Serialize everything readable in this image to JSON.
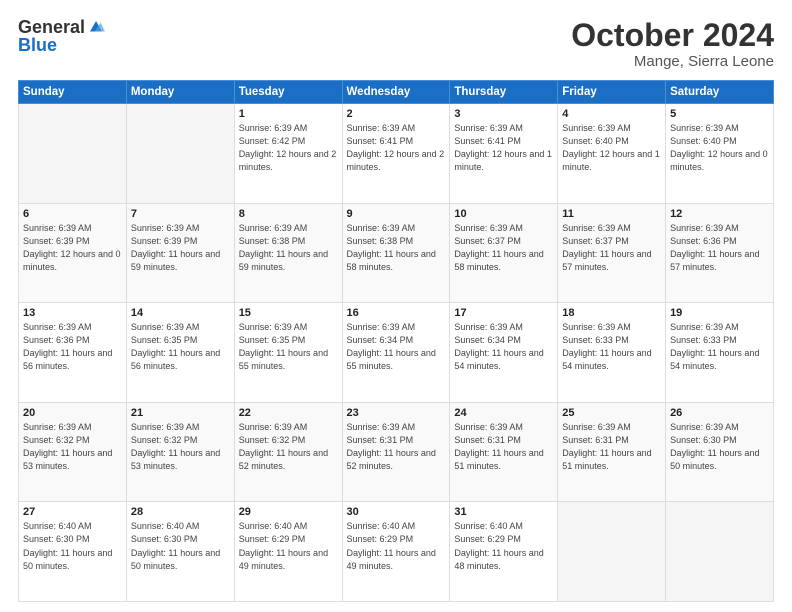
{
  "logo": {
    "general": "General",
    "blue": "Blue"
  },
  "header": {
    "month": "October 2024",
    "location": "Mange, Sierra Leone"
  },
  "days_of_week": [
    "Sunday",
    "Monday",
    "Tuesday",
    "Wednesday",
    "Thursday",
    "Friday",
    "Saturday"
  ],
  "weeks": [
    [
      {
        "day": "",
        "sunrise": "",
        "sunset": "",
        "daylight": ""
      },
      {
        "day": "",
        "sunrise": "",
        "sunset": "",
        "daylight": ""
      },
      {
        "day": "1",
        "sunrise": "Sunrise: 6:39 AM",
        "sunset": "Sunset: 6:42 PM",
        "daylight": "Daylight: 12 hours and 2 minutes."
      },
      {
        "day": "2",
        "sunrise": "Sunrise: 6:39 AM",
        "sunset": "Sunset: 6:41 PM",
        "daylight": "Daylight: 12 hours and 2 minutes."
      },
      {
        "day": "3",
        "sunrise": "Sunrise: 6:39 AM",
        "sunset": "Sunset: 6:41 PM",
        "daylight": "Daylight: 12 hours and 1 minute."
      },
      {
        "day": "4",
        "sunrise": "Sunrise: 6:39 AM",
        "sunset": "Sunset: 6:40 PM",
        "daylight": "Daylight: 12 hours and 1 minute."
      },
      {
        "day": "5",
        "sunrise": "Sunrise: 6:39 AM",
        "sunset": "Sunset: 6:40 PM",
        "daylight": "Daylight: 12 hours and 0 minutes."
      }
    ],
    [
      {
        "day": "6",
        "sunrise": "Sunrise: 6:39 AM",
        "sunset": "Sunset: 6:39 PM",
        "daylight": "Daylight: 12 hours and 0 minutes."
      },
      {
        "day": "7",
        "sunrise": "Sunrise: 6:39 AM",
        "sunset": "Sunset: 6:39 PM",
        "daylight": "Daylight: 11 hours and 59 minutes."
      },
      {
        "day": "8",
        "sunrise": "Sunrise: 6:39 AM",
        "sunset": "Sunset: 6:38 PM",
        "daylight": "Daylight: 11 hours and 59 minutes."
      },
      {
        "day": "9",
        "sunrise": "Sunrise: 6:39 AM",
        "sunset": "Sunset: 6:38 PM",
        "daylight": "Daylight: 11 hours and 58 minutes."
      },
      {
        "day": "10",
        "sunrise": "Sunrise: 6:39 AM",
        "sunset": "Sunset: 6:37 PM",
        "daylight": "Daylight: 11 hours and 58 minutes."
      },
      {
        "day": "11",
        "sunrise": "Sunrise: 6:39 AM",
        "sunset": "Sunset: 6:37 PM",
        "daylight": "Daylight: 11 hours and 57 minutes."
      },
      {
        "day": "12",
        "sunrise": "Sunrise: 6:39 AM",
        "sunset": "Sunset: 6:36 PM",
        "daylight": "Daylight: 11 hours and 57 minutes."
      }
    ],
    [
      {
        "day": "13",
        "sunrise": "Sunrise: 6:39 AM",
        "sunset": "Sunset: 6:36 PM",
        "daylight": "Daylight: 11 hours and 56 minutes."
      },
      {
        "day": "14",
        "sunrise": "Sunrise: 6:39 AM",
        "sunset": "Sunset: 6:35 PM",
        "daylight": "Daylight: 11 hours and 56 minutes."
      },
      {
        "day": "15",
        "sunrise": "Sunrise: 6:39 AM",
        "sunset": "Sunset: 6:35 PM",
        "daylight": "Daylight: 11 hours and 55 minutes."
      },
      {
        "day": "16",
        "sunrise": "Sunrise: 6:39 AM",
        "sunset": "Sunset: 6:34 PM",
        "daylight": "Daylight: 11 hours and 55 minutes."
      },
      {
        "day": "17",
        "sunrise": "Sunrise: 6:39 AM",
        "sunset": "Sunset: 6:34 PM",
        "daylight": "Daylight: 11 hours and 54 minutes."
      },
      {
        "day": "18",
        "sunrise": "Sunrise: 6:39 AM",
        "sunset": "Sunset: 6:33 PM",
        "daylight": "Daylight: 11 hours and 54 minutes."
      },
      {
        "day": "19",
        "sunrise": "Sunrise: 6:39 AM",
        "sunset": "Sunset: 6:33 PM",
        "daylight": "Daylight: 11 hours and 54 minutes."
      }
    ],
    [
      {
        "day": "20",
        "sunrise": "Sunrise: 6:39 AM",
        "sunset": "Sunset: 6:32 PM",
        "daylight": "Daylight: 11 hours and 53 minutes."
      },
      {
        "day": "21",
        "sunrise": "Sunrise: 6:39 AM",
        "sunset": "Sunset: 6:32 PM",
        "daylight": "Daylight: 11 hours and 53 minutes."
      },
      {
        "day": "22",
        "sunrise": "Sunrise: 6:39 AM",
        "sunset": "Sunset: 6:32 PM",
        "daylight": "Daylight: 11 hours and 52 minutes."
      },
      {
        "day": "23",
        "sunrise": "Sunrise: 6:39 AM",
        "sunset": "Sunset: 6:31 PM",
        "daylight": "Daylight: 11 hours and 52 minutes."
      },
      {
        "day": "24",
        "sunrise": "Sunrise: 6:39 AM",
        "sunset": "Sunset: 6:31 PM",
        "daylight": "Daylight: 11 hours and 51 minutes."
      },
      {
        "day": "25",
        "sunrise": "Sunrise: 6:39 AM",
        "sunset": "Sunset: 6:31 PM",
        "daylight": "Daylight: 11 hours and 51 minutes."
      },
      {
        "day": "26",
        "sunrise": "Sunrise: 6:39 AM",
        "sunset": "Sunset: 6:30 PM",
        "daylight": "Daylight: 11 hours and 50 minutes."
      }
    ],
    [
      {
        "day": "27",
        "sunrise": "Sunrise: 6:40 AM",
        "sunset": "Sunset: 6:30 PM",
        "daylight": "Daylight: 11 hours and 50 minutes."
      },
      {
        "day": "28",
        "sunrise": "Sunrise: 6:40 AM",
        "sunset": "Sunset: 6:30 PM",
        "daylight": "Daylight: 11 hours and 50 minutes."
      },
      {
        "day": "29",
        "sunrise": "Sunrise: 6:40 AM",
        "sunset": "Sunset: 6:29 PM",
        "daylight": "Daylight: 11 hours and 49 minutes."
      },
      {
        "day": "30",
        "sunrise": "Sunrise: 6:40 AM",
        "sunset": "Sunset: 6:29 PM",
        "daylight": "Daylight: 11 hours and 49 minutes."
      },
      {
        "day": "31",
        "sunrise": "Sunrise: 6:40 AM",
        "sunset": "Sunset: 6:29 PM",
        "daylight": "Daylight: 11 hours and 48 minutes."
      },
      {
        "day": "",
        "sunrise": "",
        "sunset": "",
        "daylight": ""
      },
      {
        "day": "",
        "sunrise": "",
        "sunset": "",
        "daylight": ""
      }
    ]
  ]
}
